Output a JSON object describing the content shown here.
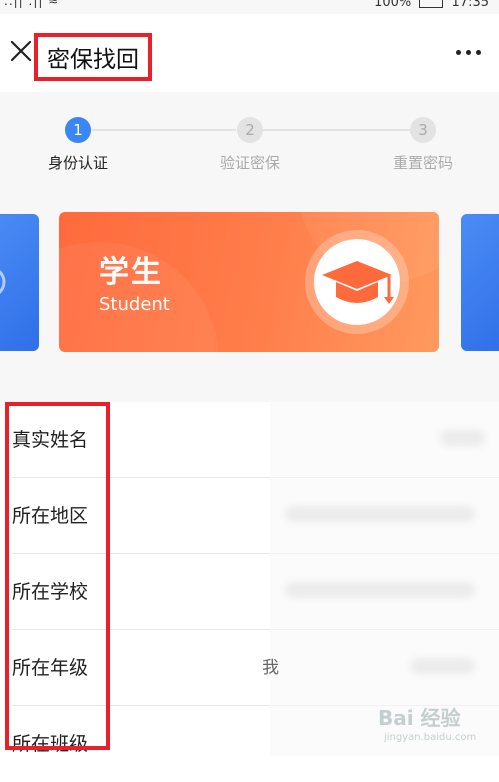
{
  "status_bar": {
    "left": "..|| .|| ≈",
    "battery": "100%",
    "time": "17:35"
  },
  "nav": {
    "title": "密保找回",
    "close_icon": "close-icon",
    "more_icon": "more-icon"
  },
  "steps": [
    {
      "number": "1",
      "label": "身份认证",
      "active": true
    },
    {
      "number": "2",
      "label": "验证密保",
      "active": false
    },
    {
      "number": "3",
      "label": "重置密码",
      "active": false
    }
  ],
  "card": {
    "title": "学生",
    "subtitle": "Student",
    "icon": "graduation-cap-icon"
  },
  "form": {
    "rows": [
      {
        "label": "真实姓名"
      },
      {
        "label": "所在地区"
      },
      {
        "label": "所在学校"
      },
      {
        "label": "所在年级"
      },
      {
        "label": "所在班级"
      }
    ],
    "stray_char": "我"
  },
  "watermark": {
    "text": "Bai 经验",
    "sub": "jingyan.baidu.com"
  },
  "colors": {
    "accent_blue": "#3a86f3",
    "card_orange": "#ff6a3d",
    "highlight_red": "#e8202a"
  }
}
